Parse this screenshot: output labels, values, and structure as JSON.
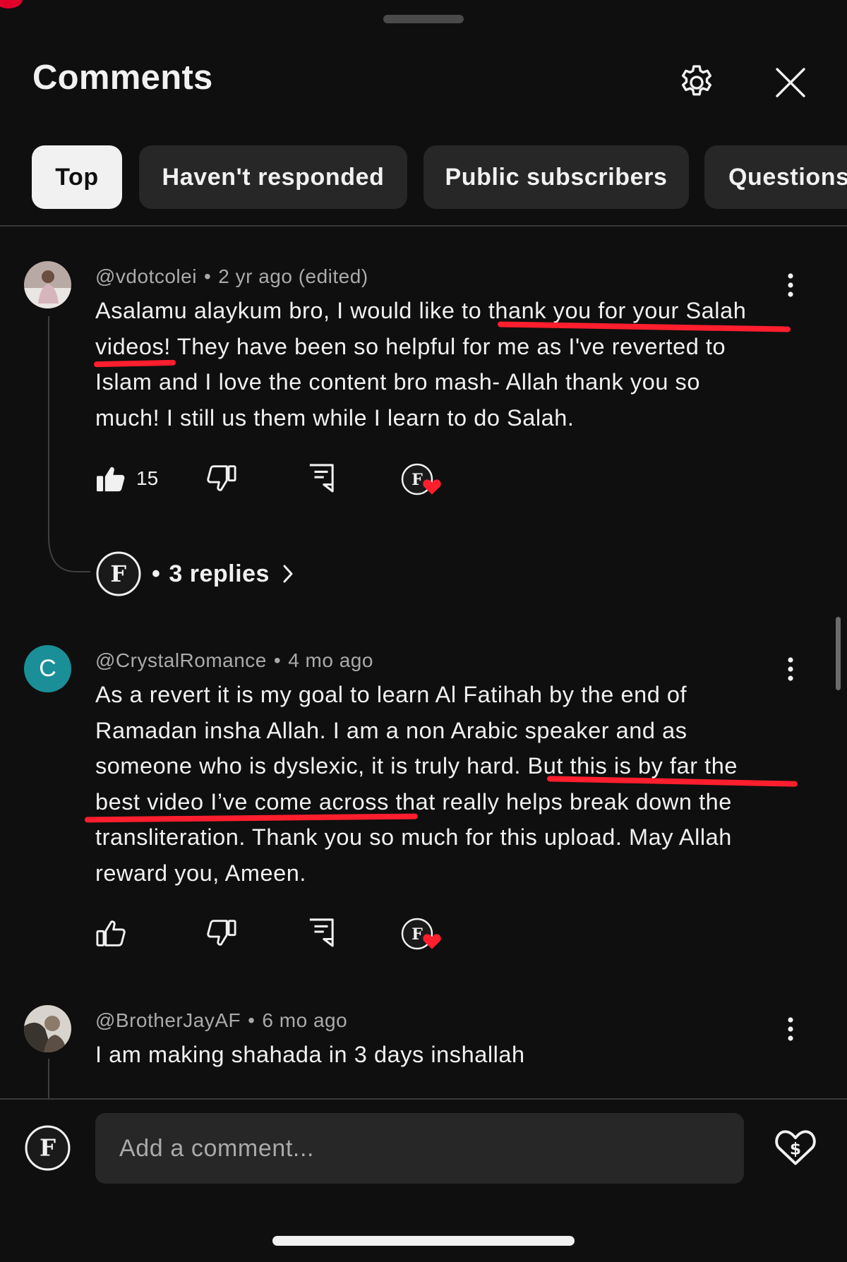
{
  "header": {
    "title": "Comments"
  },
  "filters": [
    {
      "label": "Top",
      "active": true
    },
    {
      "label": "Haven't responded",
      "active": false
    },
    {
      "label": "Public subscribers",
      "active": false
    },
    {
      "label": "Questions",
      "active": false
    }
  ],
  "comments": [
    {
      "author": "@vdotcolei",
      "age": "2 yr ago (edited)",
      "lines": [
        "Asalamu alaykum bro, I would like to thank you for your Salah",
        "videos! They have been so helpful for me as I've reverted to",
        "Islam and I love the content bro mash- Allah thank you so",
        "much! I still us them while I learn to do Salah."
      ],
      "likes": "15",
      "replies_label": "3 replies"
    },
    {
      "author": "@CrystalRomance",
      "avatar_letter": "C",
      "age": "4 mo ago",
      "lines": [
        "As a revert it is my goal to learn Al Fatihah by the end of",
        "Ramadan insha Allah. I am a non Arabic speaker and as",
        "someone who is dyslexic, it is truly hard. But this is by far the",
        "best video I’ve come across that really helps break down the",
        "transliteration. Thank you so much for this upload. May Allah",
        "reward you, Ameen."
      ]
    },
    {
      "author": "@BrotherJayAF",
      "age": "6 mo ago",
      "lines": [
        "I am making shahada in 3 days inshallah"
      ]
    }
  ],
  "composer": {
    "placeholder": "Add a comment..."
  },
  "colors": {
    "background": "#0f0f0f",
    "chip": "#272727",
    "accent_red": "#ff1e2d",
    "avatar_teal": "#1a8f98"
  }
}
